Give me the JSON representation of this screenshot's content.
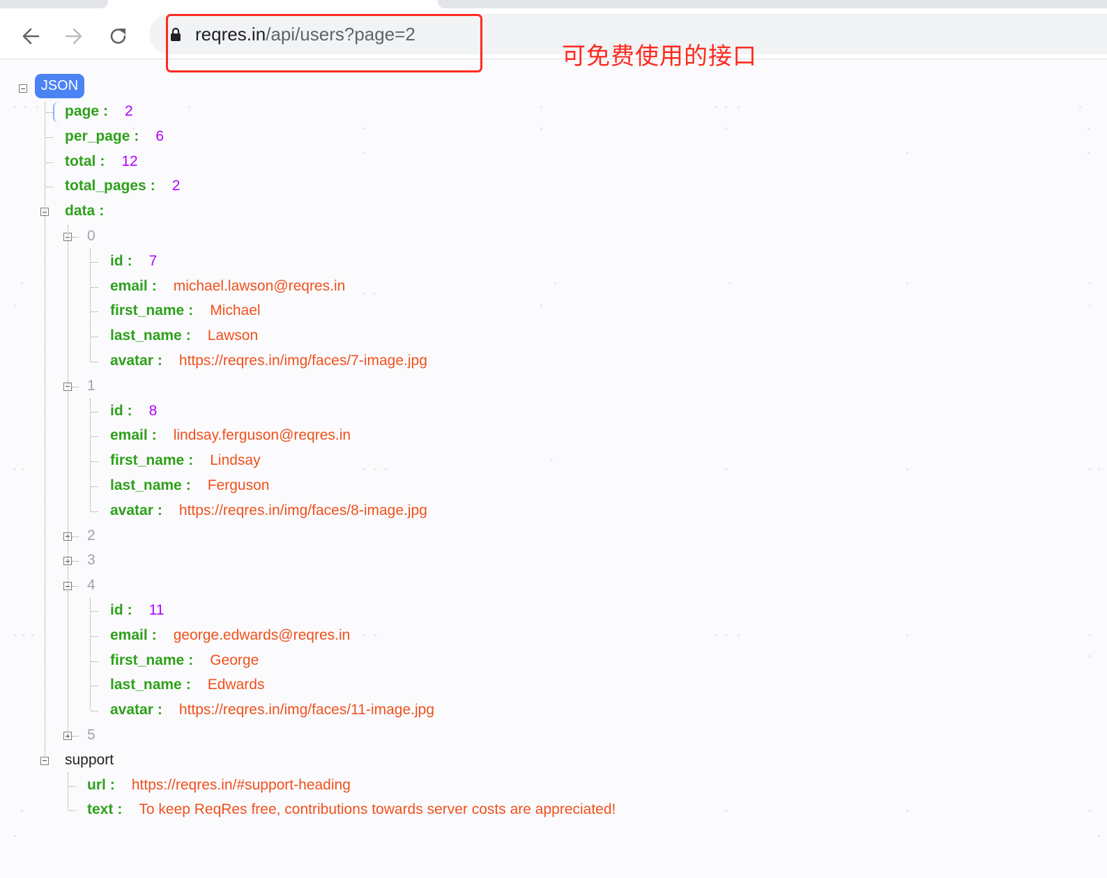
{
  "browser": {
    "url_host": "reqres.in",
    "url_path": "/api/users?page=2"
  },
  "annotation": "可免费使用的接口",
  "json_badge": "JSON",
  "top": [
    {
      "key": "page",
      "value": "2",
      "type": "num"
    },
    {
      "key": "per_page",
      "value": "6",
      "type": "num"
    },
    {
      "key": "total",
      "value": "12",
      "type": "num"
    },
    {
      "key": "total_pages",
      "value": "2",
      "type": "num"
    }
  ],
  "data_key": "data",
  "data_items": [
    {
      "index": "0",
      "expanded": true,
      "fields": [
        {
          "key": "id",
          "value": "7",
          "type": "num"
        },
        {
          "key": "email",
          "value": "michael.lawson@reqres.in",
          "type": "str"
        },
        {
          "key": "first_name",
          "value": "Michael",
          "type": "str"
        },
        {
          "key": "last_name",
          "value": "Lawson",
          "type": "str"
        },
        {
          "key": "avatar",
          "value": "https://reqres.in/img/faces/7-image.jpg",
          "type": "str"
        }
      ]
    },
    {
      "index": "1",
      "expanded": true,
      "fields": [
        {
          "key": "id",
          "value": "8",
          "type": "num"
        },
        {
          "key": "email",
          "value": "lindsay.ferguson@reqres.in",
          "type": "str"
        },
        {
          "key": "first_name",
          "value": "Lindsay",
          "type": "str"
        },
        {
          "key": "last_name",
          "value": "Ferguson",
          "type": "str"
        },
        {
          "key": "avatar",
          "value": "https://reqres.in/img/faces/8-image.jpg",
          "type": "str"
        }
      ]
    },
    {
      "index": "2",
      "expanded": false,
      "fields": []
    },
    {
      "index": "3",
      "expanded": false,
      "fields": []
    },
    {
      "index": "4",
      "expanded": true,
      "fields": [
        {
          "key": "id",
          "value": "11",
          "type": "num"
        },
        {
          "key": "email",
          "value": "george.edwards@reqres.in",
          "type": "str"
        },
        {
          "key": "first_name",
          "value": "George",
          "type": "str"
        },
        {
          "key": "last_name",
          "value": "Edwards",
          "type": "str"
        },
        {
          "key": "avatar",
          "value": "https://reqres.in/img/faces/11-image.jpg",
          "type": "str"
        }
      ]
    },
    {
      "index": "5",
      "expanded": false,
      "fields": []
    }
  ],
  "support_key": "support",
  "support": [
    {
      "key": "url",
      "value": "https://reqres.in/#support-heading",
      "type": "str"
    },
    {
      "key": "text",
      "value": "To keep ReqRes free, contributions towards server costs are appreciated!",
      "type": "str"
    }
  ],
  "colors": {
    "key": "#2ea01b",
    "number": "#b000ff",
    "string": "#f0501c",
    "badge": "#4b83f4",
    "annotation": "#ff2a1f"
  }
}
